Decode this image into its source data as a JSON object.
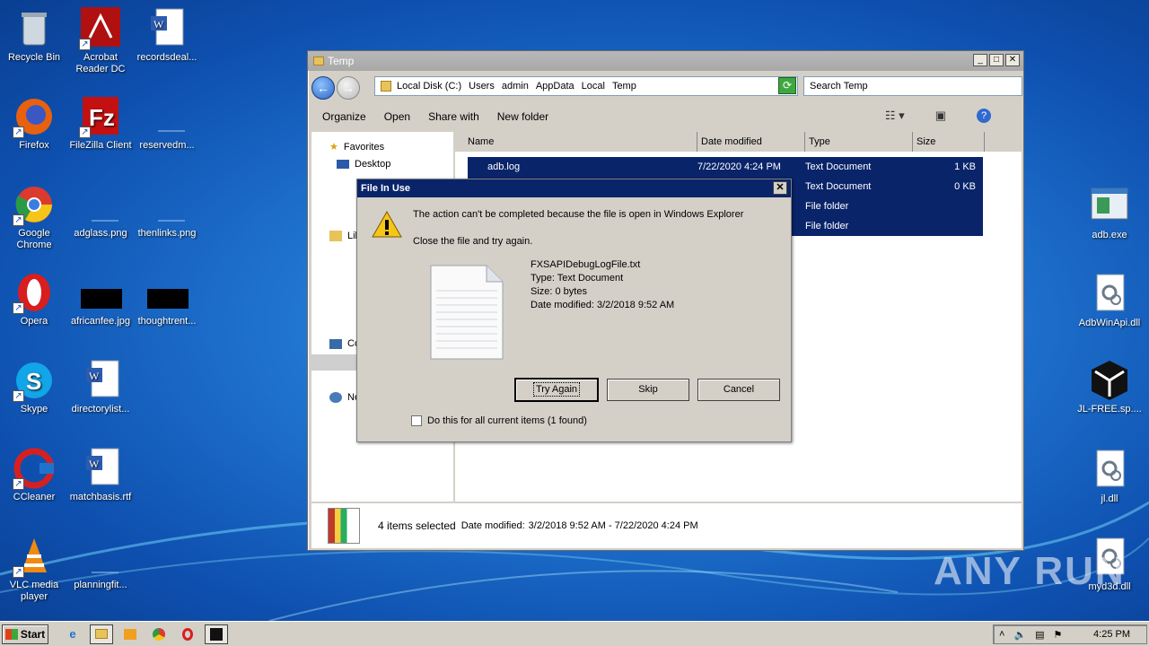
{
  "desktop": {
    "left_icons": [
      {
        "label": "Recycle Bin"
      },
      {
        "label": "Acrobat Reader DC"
      },
      {
        "label": "recordsdeal..."
      },
      {
        "label": "Firefox"
      },
      {
        "label": "FileZilla Client"
      },
      {
        "label": "reservedm..."
      },
      {
        "label": "Google Chrome"
      },
      {
        "label": "adglass.png"
      },
      {
        "label": "thenlinks.png"
      },
      {
        "label": "Opera"
      },
      {
        "label": "africanfee.jpg"
      },
      {
        "label": "thoughtrent..."
      },
      {
        "label": "Skype"
      },
      {
        "label": "directorylist..."
      },
      {
        "label": "CCleaner"
      },
      {
        "label": "matchbasis.rtf"
      },
      {
        "label": "VLC media player"
      },
      {
        "label": "planningfit..."
      }
    ],
    "right_icons": [
      {
        "label": "adb.exe"
      },
      {
        "label": "AdbWinApi.dll"
      },
      {
        "label": "JL-FREE.sp...."
      },
      {
        "label": "jl.dll"
      },
      {
        "label": "myd3d.dll"
      }
    ]
  },
  "explorer": {
    "title": "Temp",
    "breadcrumbs": [
      "Local Disk (C:)",
      "Users",
      "admin",
      "AppData",
      "Local",
      "Temp"
    ],
    "search_placeholder": "Search Temp",
    "toolbar": {
      "organize": "Organize",
      "open": "Open",
      "share_with": "Share with",
      "new_folder": "New folder"
    },
    "nav": {
      "favorites": "Favorites",
      "desktop": "Desktop",
      "libraries": "Lib",
      "computer": "Co",
      "network": "Ne"
    },
    "columns": [
      "Name",
      "Date modified",
      "Type",
      "Size"
    ],
    "rows": [
      {
        "name": "adb.log",
        "date": "7/22/2020 4:24 PM",
        "type": "Text Document",
        "size": "1 KB"
      },
      {
        "name": "",
        "date": "",
        "type": "Text Document",
        "size": "0 KB"
      },
      {
        "name": "",
        "date": "",
        "type": "File folder",
        "size": ""
      },
      {
        "name": "",
        "date": "",
        "type": "File folder",
        "size": ""
      }
    ],
    "details": {
      "selected": "4 items selected",
      "date_label": "Date modified:",
      "date_range": "3/2/2018 9:52 AM - 7/22/2020 4:24 PM"
    }
  },
  "dialog": {
    "title": "File In Use",
    "message": "The action can't be completed because the file is open in Windows Explorer",
    "submessage": "Close the file and try again.",
    "file_name": "FXSAPIDebugLogFile.txt",
    "file_type": "Type: Text Document",
    "file_size": "Size: 0 bytes",
    "file_date": "Date modified: 3/2/2018 9:52 AM",
    "buttons": {
      "try_again": "Try Again",
      "skip": "Skip",
      "cancel": "Cancel"
    },
    "checkbox_label": "Do this for all current items (1 found)"
  },
  "taskbar": {
    "start": "Start",
    "clock": "4:25 PM"
  },
  "watermark": "ANY RUN"
}
